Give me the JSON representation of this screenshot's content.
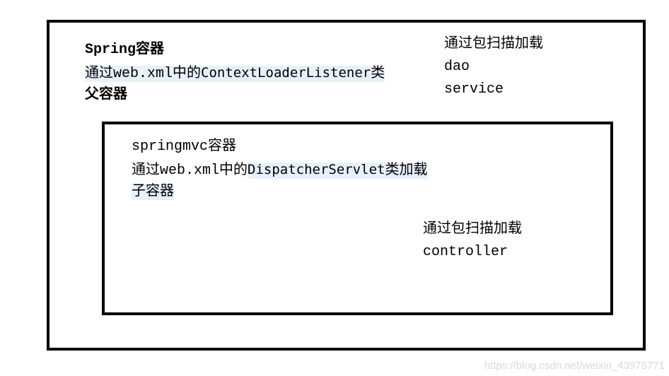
{
  "outer": {
    "title": "Spring容器",
    "line2_prefix": "通过web.xml中的",
    "line2_class": "ContextLoaderListener",
    "line2_suffix": "类",
    "role": "父容器",
    "scan_label": "通过包扫描加载",
    "scan_items": [
      "dao",
      "service"
    ]
  },
  "inner": {
    "title": "springmvc容器",
    "line2_prefix": "通过web.xml中的",
    "line2_class": "DispatcherServlet",
    "line2_suffix": "类加载",
    "role": "子容器",
    "scan_label": "通过包扫描加载",
    "scan_items": [
      "controller"
    ]
  },
  "watermark": "https://blog.csdn.net/weixin_43975771"
}
